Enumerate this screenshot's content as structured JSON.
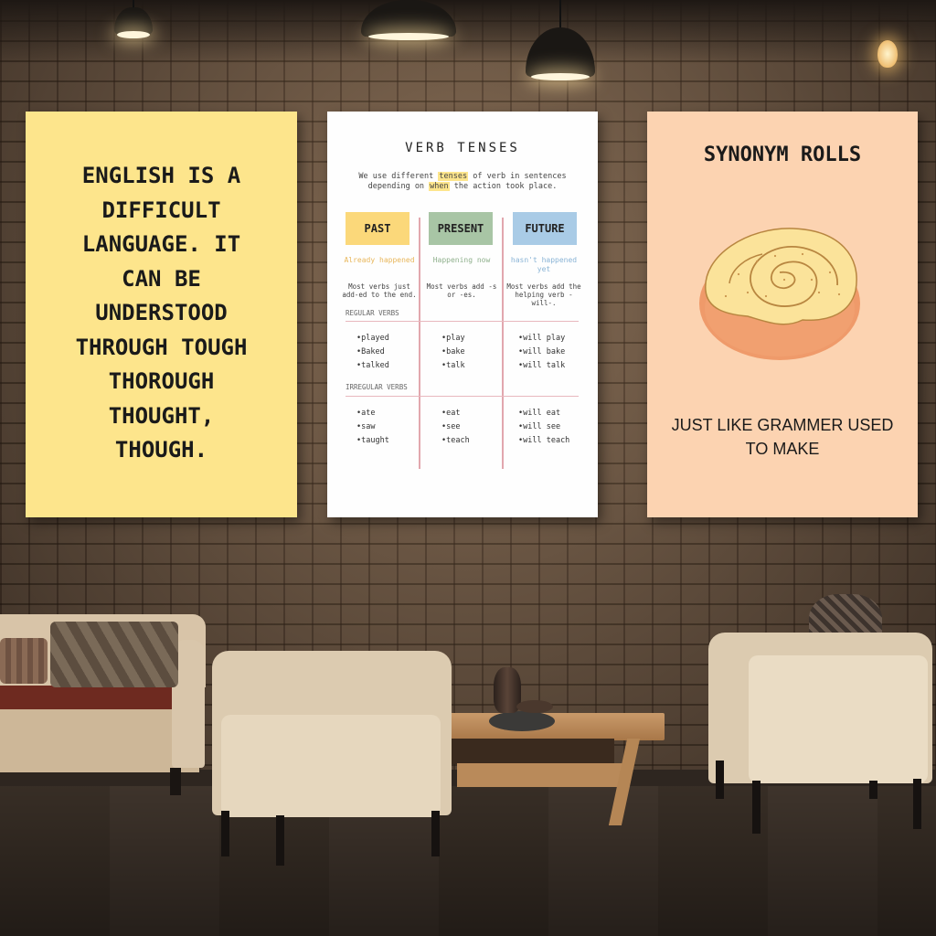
{
  "posters": {
    "quote": {
      "text": "ENGLISH IS A\nDIFFICULT\nLANGUAGE. IT\nCAN BE\nUNDERSTOOD\nTHROUGH TOUGH\nTHOROUGH\nTHOUGHT,\nTHOUGH.",
      "background": "#fde58c"
    },
    "verb_tenses": {
      "title": "VERB TENSES",
      "intro_a": "We use different ",
      "intro_hl1": "tenses",
      "intro_b": " of verb in sentences depending on ",
      "intro_hl2": "when",
      "intro_c": " the action took place.",
      "columns": [
        {
          "label": "PAST",
          "when": "Already happened",
          "rule": "Most verbs just add-ed to the end.",
          "regular": [
            "played",
            "Baked",
            "talked"
          ],
          "irregular": [
            "ate",
            "saw",
            "taught"
          ]
        },
        {
          "label": "PRESENT",
          "when": "Happening now",
          "rule": "Most verbs add -s or -es.",
          "regular": [
            "play",
            "bake",
            "talk"
          ],
          "irregular": [
            "eat",
            "see",
            "teach"
          ]
        },
        {
          "label": "FUTURE",
          "when": "hasn't happened yet",
          "rule": "Most verbs add the helping verb -will-.",
          "regular": [
            "will play",
            "will bake",
            "will talk"
          ],
          "irregular": [
            "will eat",
            "will see",
            "will teach"
          ]
        }
      ],
      "section_regular": "REGULAR VERBS",
      "section_irregular": "IRREGULAR VERBS",
      "colors": {
        "past": "#fbd87a",
        "present": "#a8c5a5",
        "future": "#a9cbe6"
      }
    },
    "synonym": {
      "title": "SYNONYM ROLLS",
      "caption": "JUST LIKE GRAMMER USED TO MAKE",
      "illustration": "cinnamon-roll-icon",
      "background": "#fcd3b1"
    }
  }
}
